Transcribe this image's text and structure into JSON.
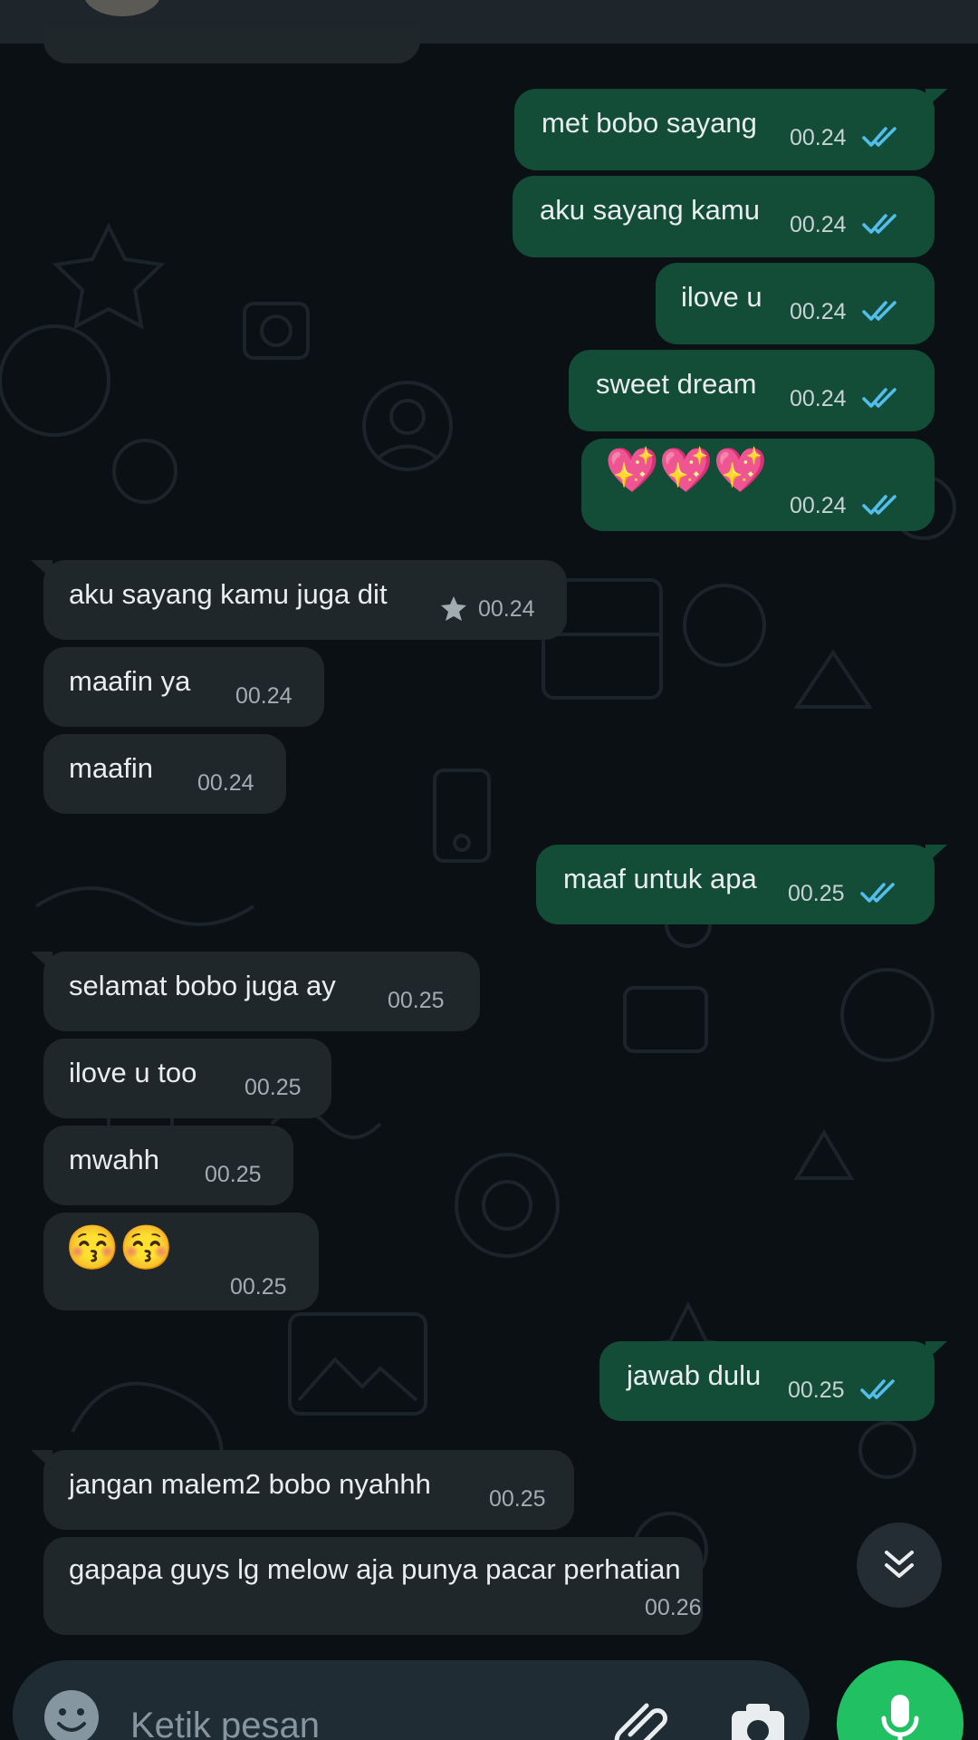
{
  "messages": [
    {
      "dir": "out",
      "text": "met bobo sayang",
      "time": "00.24",
      "ticks": "read"
    },
    {
      "dir": "out",
      "text": "aku sayang kamu",
      "time": "00.24",
      "ticks": "read"
    },
    {
      "dir": "out",
      "text": "ilove u",
      "time": "00.24",
      "ticks": "read"
    },
    {
      "dir": "out",
      "text": "sweet dream",
      "time": "00.24",
      "ticks": "read"
    },
    {
      "dir": "out",
      "text": "💖💖💖",
      "time": "00.24",
      "ticks": "read"
    },
    {
      "dir": "in",
      "text": "aku sayang kamu juga dit",
      "time": "00.24",
      "starred": true
    },
    {
      "dir": "in",
      "text": "maafin ya",
      "time": "00.24"
    },
    {
      "dir": "in",
      "text": "maafin",
      "time": "00.24"
    },
    {
      "dir": "out",
      "text": "maaf untuk apa",
      "time": "00.25",
      "ticks": "read"
    },
    {
      "dir": "in",
      "text": "selamat bobo juga ay",
      "time": "00.25"
    },
    {
      "dir": "in",
      "text": "ilove u too",
      "time": "00.25"
    },
    {
      "dir": "in",
      "text": "mwahh",
      "time": "00.25"
    },
    {
      "dir": "in",
      "text": "😚😚",
      "time": "00.25"
    },
    {
      "dir": "out",
      "text": "jawab dulu",
      "time": "00.25",
      "ticks": "read"
    },
    {
      "dir": "in",
      "text": "jangan malem2 bobo nyahhh",
      "time": "00.25"
    },
    {
      "dir": "in",
      "text": "gapapa guys lg melow aja punya pacar perhatian",
      "time": "00.26"
    }
  ],
  "composer": {
    "placeholder": "Ketik pesan"
  },
  "colors": {
    "outgoing_bubble": "#134d37",
    "incoming_bubble": "#1f272b",
    "read_ticks": "#53bdeb",
    "mic_button": "#21c063"
  }
}
